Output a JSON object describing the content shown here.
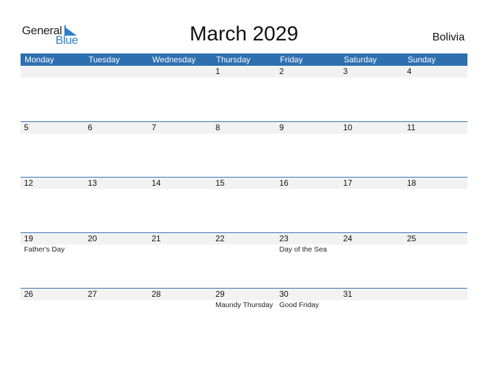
{
  "logo": {
    "text_general": "General",
    "text_blue": "Blue",
    "icon": "flag-triangle-icon"
  },
  "title": "March 2029",
  "country": "Bolivia",
  "colors": {
    "header_bg": "#2e6faf",
    "daybar_bg": "#f2f2f2",
    "logo_blue": "#2f7fc8"
  },
  "weekdays": [
    "Monday",
    "Tuesday",
    "Wednesday",
    "Thursday",
    "Friday",
    "Saturday",
    "Sunday"
  ],
  "weeks": [
    {
      "days": [
        "",
        "",
        "",
        "1",
        "2",
        "3",
        "4"
      ],
      "events": [
        "",
        "",
        "",
        "",
        "",
        "",
        ""
      ]
    },
    {
      "days": [
        "5",
        "6",
        "7",
        "8",
        "9",
        "10",
        "11"
      ],
      "events": [
        "",
        "",
        "",
        "",
        "",
        "",
        ""
      ]
    },
    {
      "days": [
        "12",
        "13",
        "14",
        "15",
        "16",
        "17",
        "18"
      ],
      "events": [
        "",
        "",
        "",
        "",
        "",
        "",
        ""
      ]
    },
    {
      "days": [
        "19",
        "20",
        "21",
        "22",
        "23",
        "24",
        "25"
      ],
      "events": [
        "Father's Day",
        "",
        "",
        "",
        "Day of the Sea",
        "",
        ""
      ]
    },
    {
      "days": [
        "26",
        "27",
        "28",
        "29",
        "30",
        "31",
        ""
      ],
      "events": [
        "",
        "",
        "",
        "Maundy Thursday",
        "Good Friday",
        "",
        ""
      ]
    }
  ]
}
